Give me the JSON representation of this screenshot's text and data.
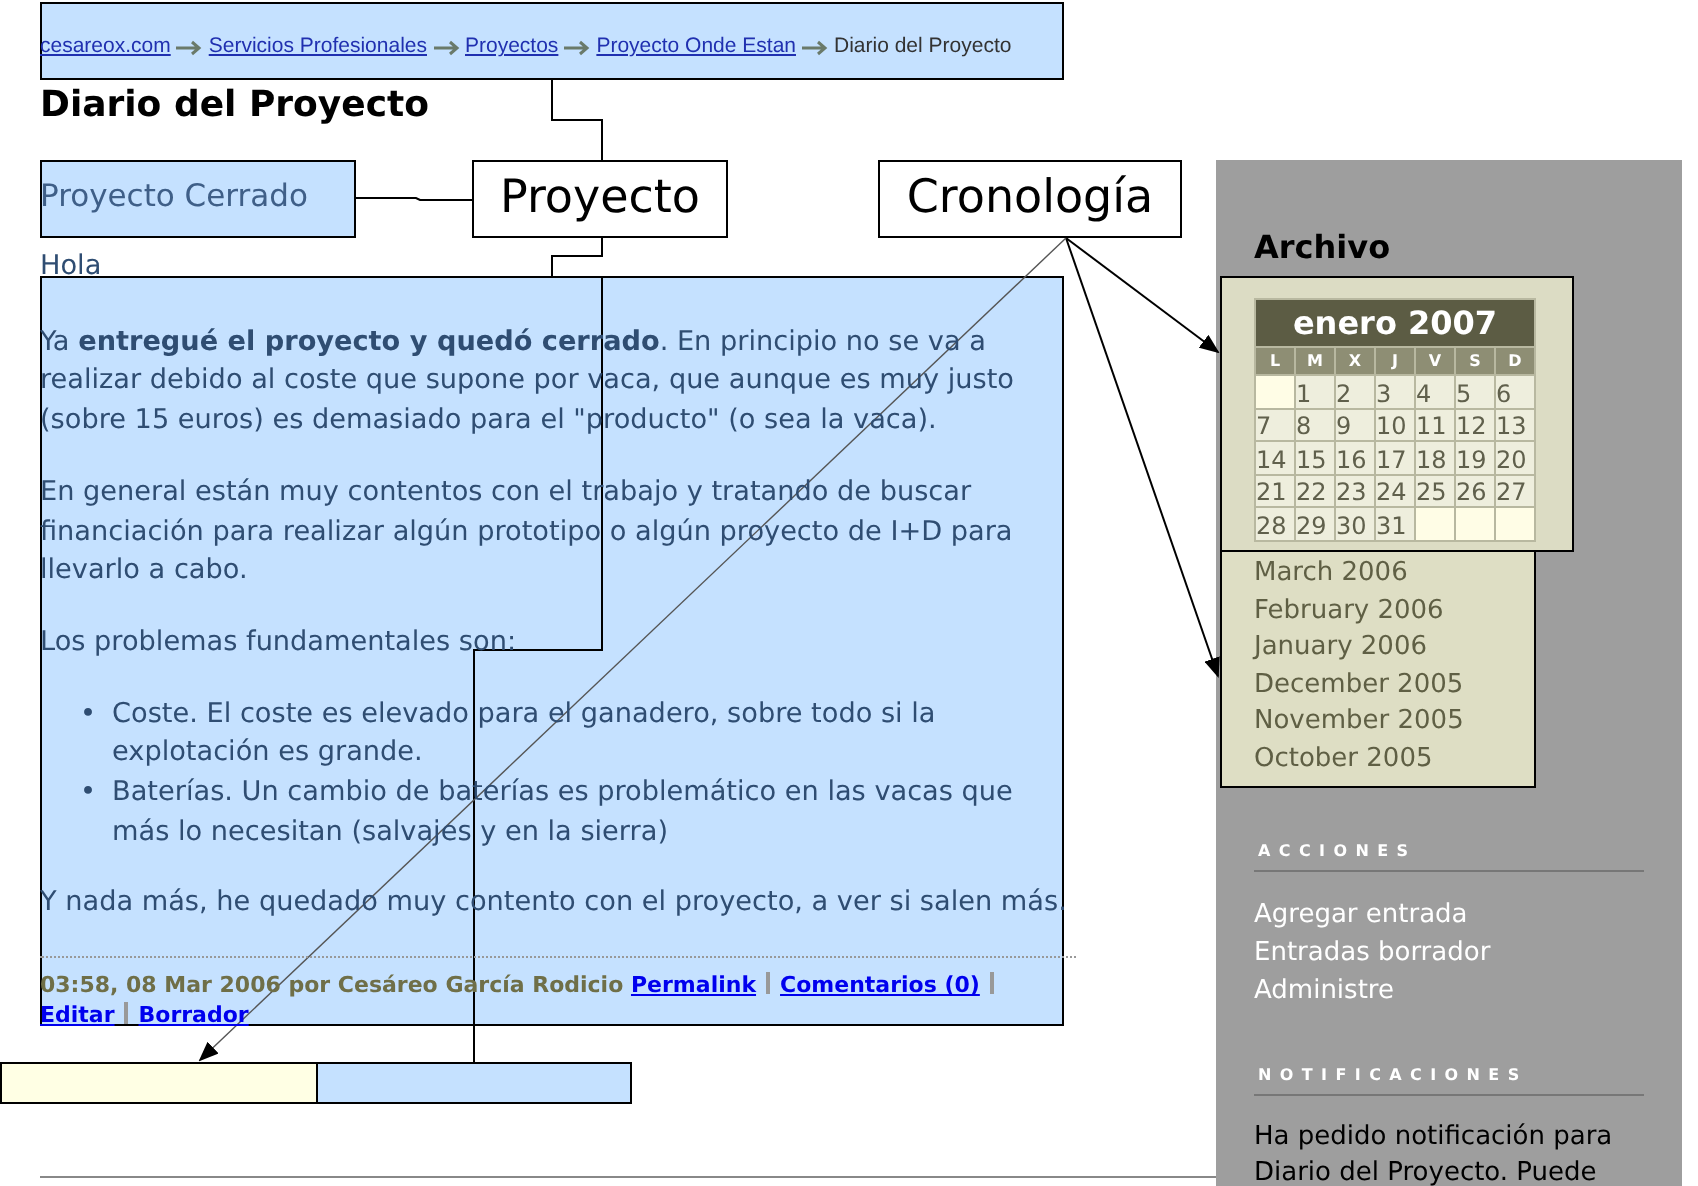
{
  "breadcrumb": [
    {
      "text": "cesareox.com",
      "kind": "link"
    },
    {
      "text": "Servicios Profesionales",
      "kind": "link"
    },
    {
      "text": "Proyectos",
      "kind": "link"
    },
    {
      "text": "Proyecto Onde Estan",
      "kind": "link"
    },
    {
      "text": "Diario del Proyecto",
      "kind": "current"
    }
  ],
  "page_title": "Diario del Proyecto",
  "post": {
    "title": "Proyecto Cerrado",
    "body": [
      {
        "kind": "p",
        "text": "Hola"
      },
      {
        "kind": "p",
        "text": "Ya **entregué el proyecto y quedó cerrado**. En principio no se va a realizar debido al coste que supone por vaca, que aunque es muy justo (sobre 15 euros) es demasiado para el \"producto\" (o sea la vaca)."
      },
      {
        "kind": "p",
        "text": "En general están muy contentos con el trabajo y tratando de buscar financiación para realizar algún prototipo o algún proyecto de I+D para llevarlo a cabo."
      },
      {
        "kind": "p",
        "text": "Los problemas fundamentales son:"
      },
      {
        "kind": "list",
        "items": [
          {
            "marker": "•",
            "text": "Coste. El coste es elevado para el ganadero, sobre todo si la explotación es grande."
          },
          {
            "marker": "•",
            "text": "Baterías. Un cambio de baterías es problemático en las vacas que más lo necesitan (salvajes y en la sierra)"
          }
        ]
      },
      {
        "kind": "p",
        "text": "Y nada más, he quedado muy contento con el proyecto, a ver si salen más."
      }
    ],
    "meta": "03:58, 08 Mar 2006 por Cesáreo García Rodicio",
    "links": [
      "Permalink",
      "Comentarios (0)",
      "Editar",
      "Borrador"
    ]
  },
  "annotations": [
    {
      "label": "Proyecto"
    },
    {
      "label": "Cronología"
    }
  ],
  "sidebar": {
    "archive_title": "Archivo",
    "calendar": {
      "title": "enero 2007",
      "weekdays": [
        "L",
        "M",
        "X",
        "J",
        "V",
        "S",
        "D"
      ],
      "weeks": [
        [
          {
            "kind": "blank"
          },
          {
            "kind": "day",
            "day": "1"
          },
          {
            "kind": "day",
            "day": "2"
          },
          {
            "kind": "day",
            "day": "3"
          },
          {
            "kind": "day",
            "day": "4"
          },
          {
            "kind": "day",
            "day": "5"
          },
          {
            "kind": "day",
            "day": "6"
          }
        ],
        [
          {
            "kind": "day",
            "day": "7"
          },
          {
            "kind": "day",
            "day": "8"
          },
          {
            "kind": "day",
            "day": "9"
          },
          {
            "kind": "day",
            "day": "10"
          },
          {
            "kind": "day",
            "day": "11"
          },
          {
            "kind": "day",
            "day": "12"
          },
          {
            "kind": "day",
            "day": "13"
          }
        ],
        [
          {
            "kind": "day",
            "day": "14"
          },
          {
            "kind": "day",
            "day": "15"
          },
          {
            "kind": "day",
            "day": "16"
          },
          {
            "kind": "day",
            "day": "17"
          },
          {
            "kind": "day",
            "day": "18"
          },
          {
            "kind": "day",
            "day": "19"
          },
          {
            "kind": "day",
            "day": "20"
          }
        ],
        [
          {
            "kind": "day",
            "day": "21"
          },
          {
            "kind": "day",
            "day": "22"
          },
          {
            "kind": "day",
            "day": "23"
          },
          {
            "kind": "day",
            "day": "24"
          },
          {
            "kind": "day",
            "day": "25"
          },
          {
            "kind": "day",
            "day": "26"
          },
          {
            "kind": "day",
            "day": "27"
          }
        ],
        [
          {
            "kind": "day",
            "day": "28"
          },
          {
            "kind": "day",
            "day": "29"
          },
          {
            "kind": "day",
            "day": "30"
          },
          {
            "kind": "day",
            "day": "31"
          },
          {
            "kind": "blank"
          },
          {
            "kind": "blank"
          },
          {
            "kind": "blank"
          }
        ]
      ]
    },
    "months": [
      "March 2006",
      "February 2006",
      "January 2006",
      "December 2005",
      "November 2005",
      "October 2005"
    ],
    "sections": [
      {
        "kind": "links",
        "heading": "ACCIONES",
        "items": [
          "Agregar entrada",
          "Entradas borrador",
          "Administre"
        ]
      },
      {
        "kind": "text",
        "heading": "NOTIFICACIONES",
        "text": "Ha pedido notificación para Diario del Proyecto. Puede"
      }
    ]
  }
}
